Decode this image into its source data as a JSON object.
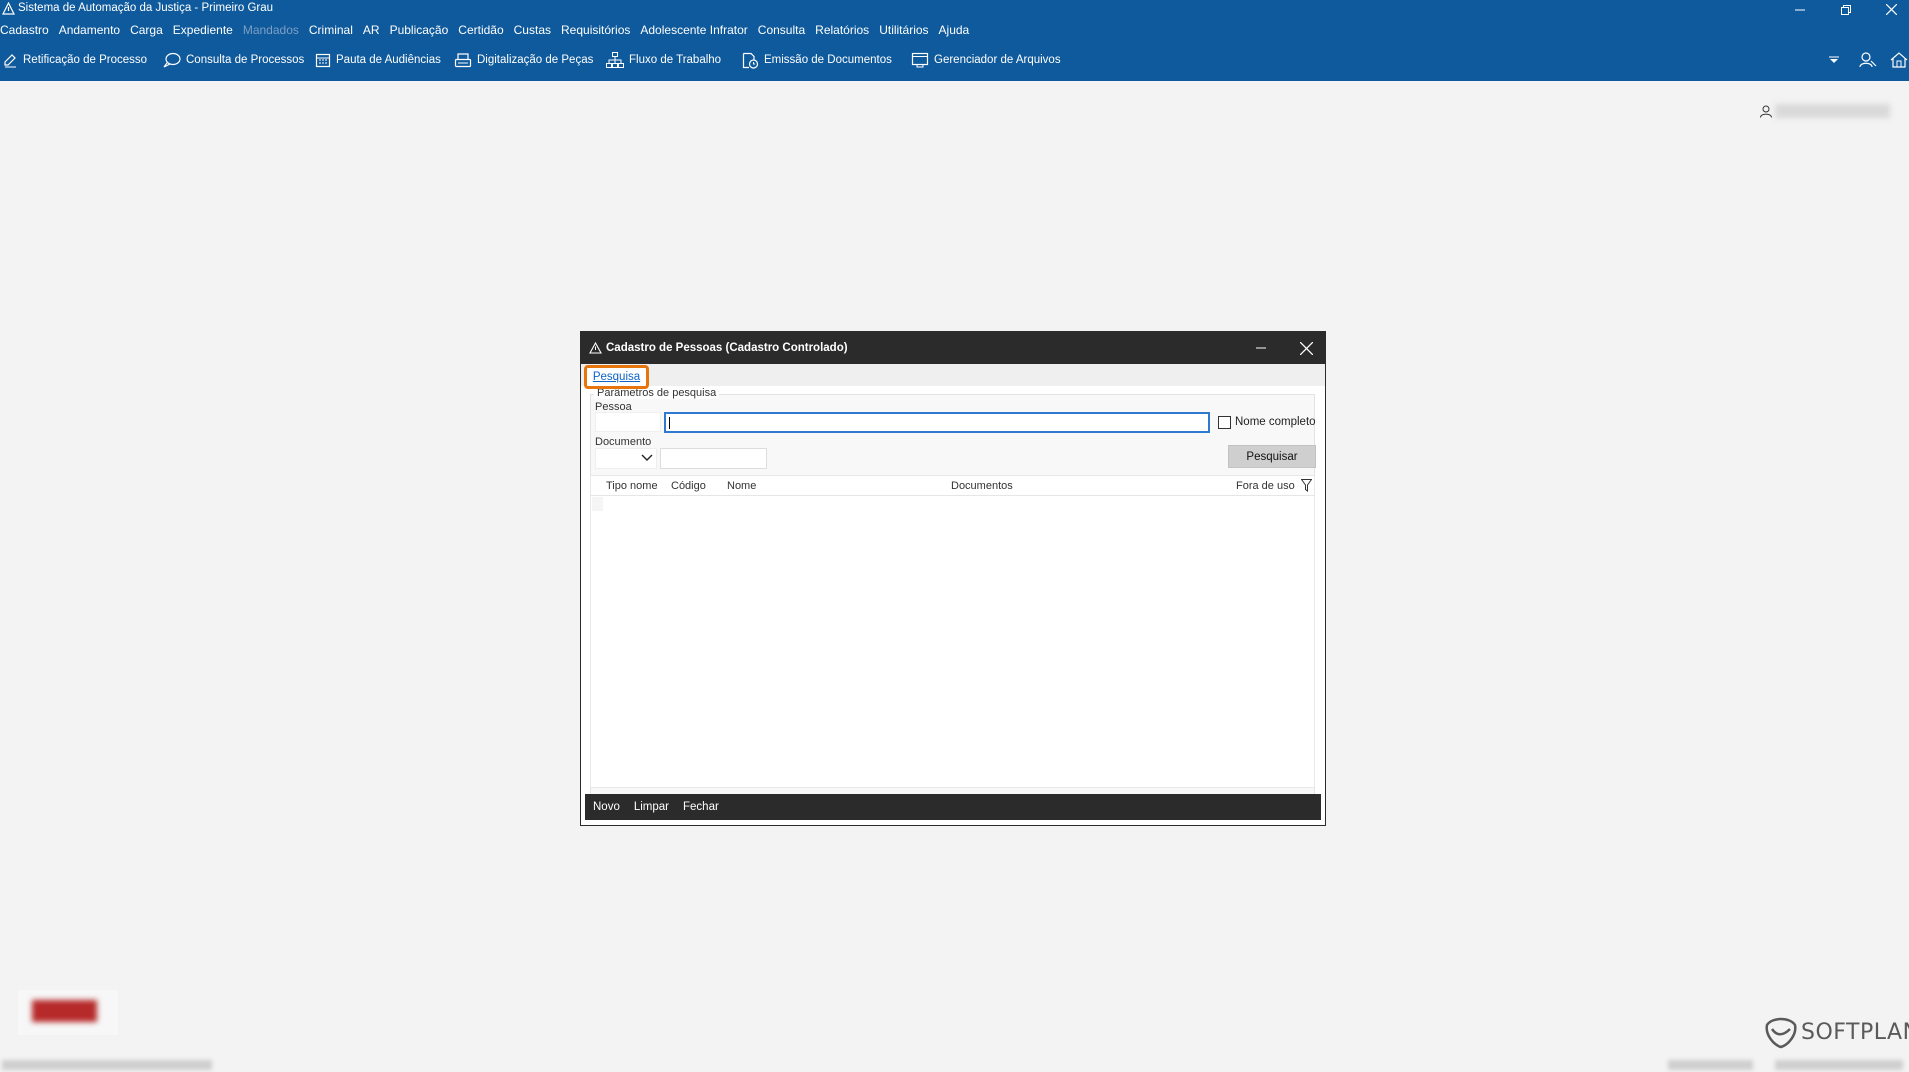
{
  "window": {
    "title": "Sistema de Automação da Justiça - Primeiro Grau",
    "icon": "warning-triangle-icon"
  },
  "menu": [
    {
      "label": "Cadastro",
      "enabled": true
    },
    {
      "label": "Andamento",
      "enabled": true
    },
    {
      "label": "Carga",
      "enabled": true
    },
    {
      "label": "Expediente",
      "enabled": true
    },
    {
      "label": "Mandados",
      "enabled": false
    },
    {
      "label": "Criminal",
      "enabled": true
    },
    {
      "label": "AR",
      "enabled": true
    },
    {
      "label": "Publicação",
      "enabled": true
    },
    {
      "label": "Certidão",
      "enabled": true
    },
    {
      "label": "Custas",
      "enabled": true
    },
    {
      "label": "Requisitórios",
      "enabled": true
    },
    {
      "label": "Adolescente Infrator",
      "enabled": true
    },
    {
      "label": "Consulta",
      "enabled": true
    },
    {
      "label": "Relatórios",
      "enabled": true
    },
    {
      "label": "Utilitários",
      "enabled": true
    },
    {
      "label": "Ajuda",
      "enabled": true
    }
  ],
  "toolbar": [
    {
      "label": "Retificação de Processo",
      "icon": "edit-icon"
    },
    {
      "label": "Consulta de Processos",
      "icon": "search-chat-icon"
    },
    {
      "label": "Pauta de Audiências",
      "icon": "calendar-icon"
    },
    {
      "label": "Digitalização de Peças",
      "icon": "scanner-icon"
    },
    {
      "label": "Fluxo de Trabalho",
      "icon": "workflow-icon"
    },
    {
      "label": "Emissão de Documentos",
      "icon": "document-icon"
    },
    {
      "label": "Gerenciador de Arquivos",
      "icon": "folder-icon"
    }
  ],
  "dialog": {
    "title": "Cadastro de Pessoas (Cadastro Controlado)",
    "tab": "Pesquisa",
    "group_label": "Parâmetros de pesquisa",
    "pessoa_label": "Pessoa",
    "pessoa_value": "",
    "nome_completo_label": "Nome completo",
    "nome_completo_checked": false,
    "documento_label": "Documento",
    "documento_tipo": "",
    "documento_value": "",
    "search_button": "Pesquisar",
    "columns": [
      "Tipo nome",
      "Código",
      "Nome",
      "Documentos",
      "Fora de uso"
    ],
    "rows": [],
    "footer": {
      "novo": "Novo",
      "limpar": "Limpar",
      "fechar": "Fechar"
    }
  },
  "brand": "SOFTPLAN",
  "colors": {
    "chrome": "#0f5a9c",
    "dialog_chrome": "#2b2b2b",
    "highlight": "#e7750d",
    "link": "#0b63c4"
  }
}
